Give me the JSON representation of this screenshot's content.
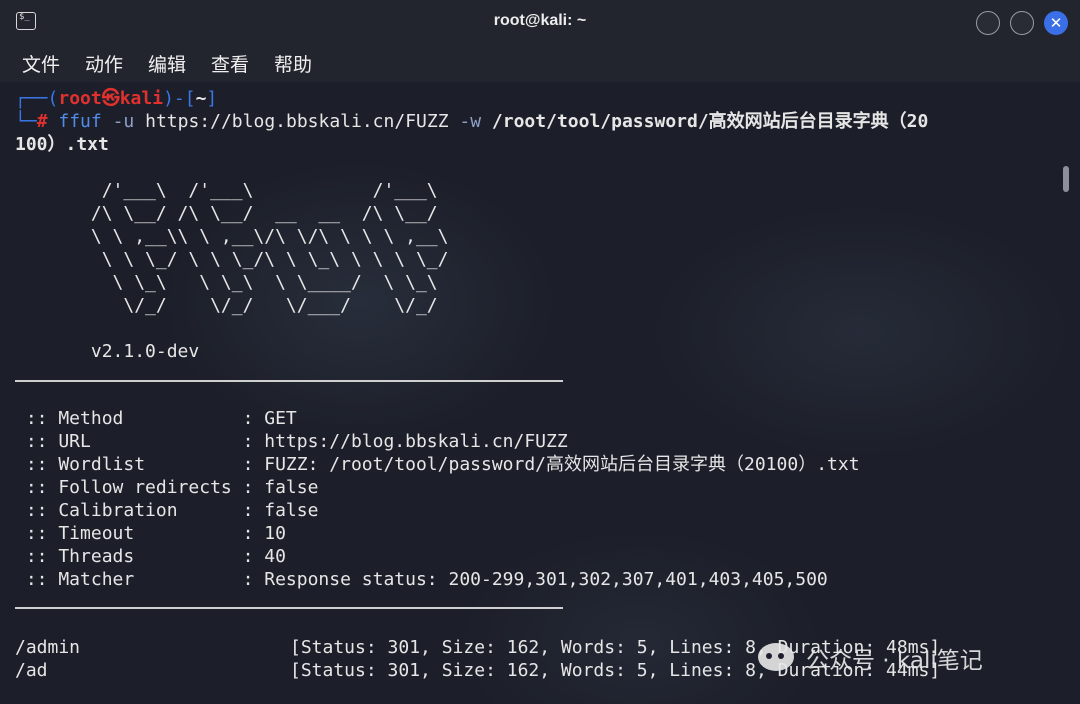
{
  "window": {
    "title": "root@kali: ~"
  },
  "menu": [
    "文件",
    "动作",
    "编辑",
    "查看",
    "帮助"
  ],
  "prompt": {
    "corner1": "┌──(",
    "user": "root㉿kali",
    "corner2": ")-[",
    "dir": "~",
    "corner3": "]",
    "corner4": "└─",
    "hash": "#",
    "cmd": "ffuf",
    "flag_u": "-u",
    "url": "https://blog.bbskali.cn/FUZZ",
    "flag_w": "-w",
    "wordlist_path_1": "/root/tool/password/高效网站后台目录字典（20",
    "wordlist_path_2": "100）.txt"
  },
  "banner": [
    "        /'___\\  /'___\\           /'___\\",
    "       /\\ \\__/ /\\ \\__/  __  __  /\\ \\__/",
    "       \\ \\ ,__\\\\ \\ ,__\\/\\ \\/\\ \\ \\ \\ ,__\\",
    "        \\ \\ \\_/ \\ \\ \\_/\\ \\ \\_\\ \\ \\ \\ \\_/",
    "         \\ \\_\\   \\ \\_\\  \\ \\____/  \\ \\_\\",
    "          \\/_/    \\/_/   \\/___/    \\/_/"
  ],
  "version": "       v2.1.0-dev",
  "config": [
    {
      "key": " :: Method           ",
      "value": ": GET"
    },
    {
      "key": " :: URL              ",
      "value": ": https://blog.bbskali.cn/FUZZ"
    },
    {
      "key": " :: Wordlist         ",
      "value": ": FUZZ: /root/tool/password/高效网站后台目录字典（20100）.txt"
    },
    {
      "key": " :: Follow redirects ",
      "value": ": false"
    },
    {
      "key": " :: Calibration      ",
      "value": ": false"
    },
    {
      "key": " :: Timeout          ",
      "value": ": 10"
    },
    {
      "key": " :: Threads          ",
      "value": ": 40"
    },
    {
      "key": " :: Matcher          ",
      "value": ": Response status: 200-299,301,302,307,401,403,405,500"
    }
  ],
  "results": [
    {
      "path": "/admin",
      "info": "[Status: 301, Size: 162, Words: 5, Lines: 8, Duration: 48ms]"
    },
    {
      "path": "/ad",
      "info": "[Status: 301, Size: 162, Words: 5, Lines: 8, Duration: 44ms]"
    }
  ],
  "watermark": "公众号 · kali笔记"
}
